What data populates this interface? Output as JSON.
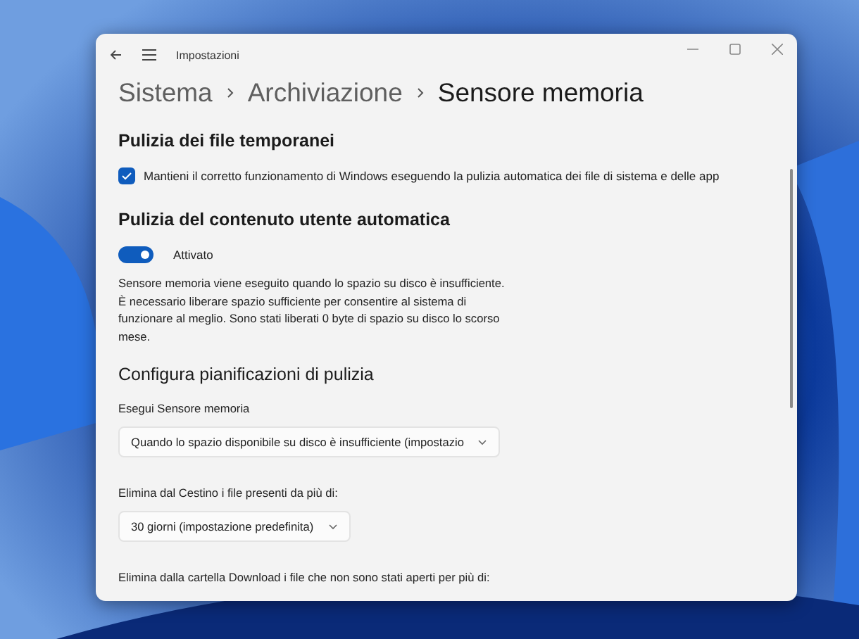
{
  "window": {
    "title": "Impostazioni"
  },
  "breadcrumb": [
    {
      "label": "Sistema",
      "selected": false
    },
    {
      "label": "Archiviazione",
      "selected": false
    },
    {
      "label": "Sensore memoria",
      "selected": true
    }
  ],
  "temp_files": {
    "heading": "Pulizia dei file temporanei",
    "checkbox": {
      "label": "Mantieni il corretto funzionamento di Windows eseguendo la pulizia automatica dei file di sistema e delle app",
      "checked": true
    }
  },
  "auto_cleanup": {
    "heading": "Pulizia del contenuto utente automatica",
    "toggle": {
      "label": "Attivato",
      "on": true
    },
    "description": "Sensore memoria viene eseguito quando lo spazio su disco è insufficiente. È necessario liberare spazio sufficiente per consentire al sistema di funzionare al meglio. Sono stati liberati 0 byte di spazio su disco lo scorso mese."
  },
  "schedules": {
    "heading": "Configura pianificazioni di pulizia",
    "settings": [
      {
        "label": "Esegui Sensore memoria",
        "value": "Quando lo spazio disponibile su disco è insufficiente (impostazio"
      },
      {
        "label": "Elimina dal Cestino i file presenti da più di:",
        "value": "30 giorni (impostazione predefinita)"
      },
      {
        "label": "Elimina dalla cartella Download i file che non sono stati aperti per più di:"
      }
    ]
  }
}
